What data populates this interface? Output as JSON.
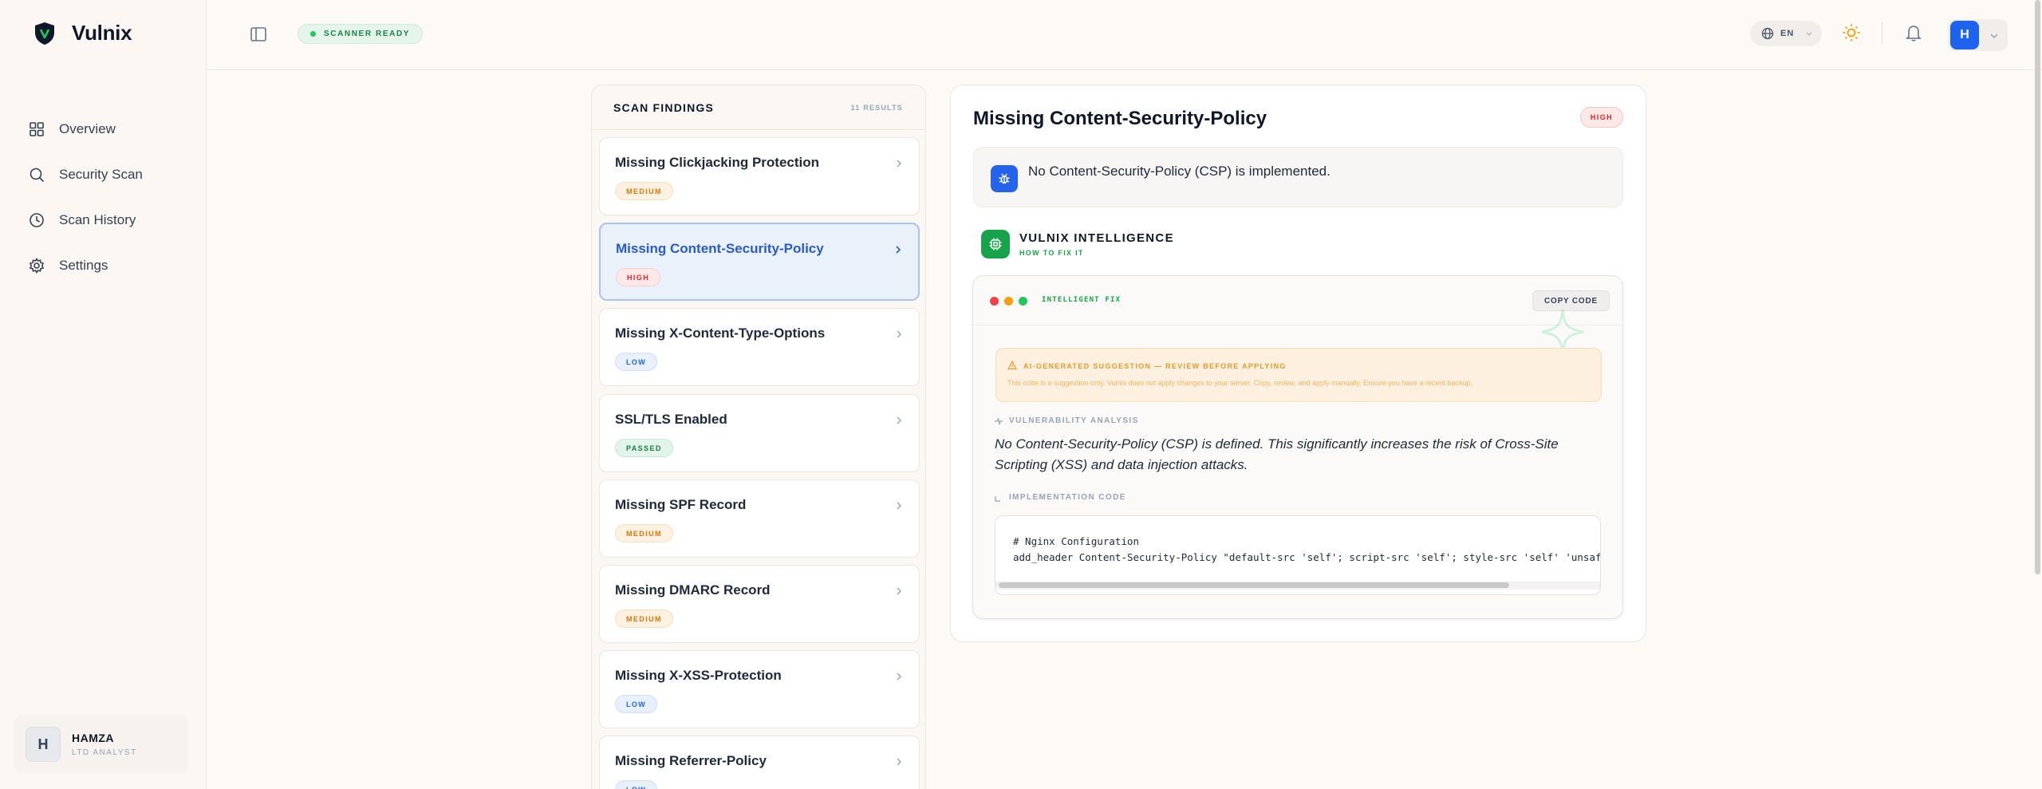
{
  "app": {
    "name": "Vulnix"
  },
  "sidebar": {
    "items": [
      {
        "label": "Overview",
        "icon": "grid-icon"
      },
      {
        "label": "Security Scan",
        "icon": "search-icon"
      },
      {
        "label": "Scan History",
        "icon": "clock-icon"
      },
      {
        "label": "Settings",
        "icon": "gear-icon"
      }
    ],
    "user": {
      "initial": "H",
      "name": "HAMZA",
      "role": "LTD ANALYST"
    }
  },
  "header": {
    "status": "SCANNER READY",
    "language": "EN",
    "avatar_initial": "H"
  },
  "findings": {
    "title": "SCAN FINDINGS",
    "count": "11 RESULTS",
    "items": [
      {
        "title": "Missing Clickjacking Protection",
        "severity": "MEDIUM"
      },
      {
        "title": "Missing Content-Security-Policy",
        "severity": "HIGH",
        "active": true
      },
      {
        "title": "Missing X-Content-Type-Options",
        "severity": "LOW"
      },
      {
        "title": "SSL/TLS Enabled",
        "severity": "PASSED"
      },
      {
        "title": "Missing SPF Record",
        "severity": "MEDIUM"
      },
      {
        "title": "Missing DMARC Record",
        "severity": "MEDIUM"
      },
      {
        "title": "Missing X-XSS-Protection",
        "severity": "LOW"
      },
      {
        "title": "Missing Referrer-Policy",
        "severity": "LOW"
      }
    ]
  },
  "detail": {
    "title": "Missing Content-Security-Policy",
    "severity": "HIGH",
    "description": "No Content-Security-Policy (CSP) is implemented.",
    "intel_title": "VULNIX INTELLIGENCE",
    "intel_subtitle": "HOW TO FIX IT",
    "fix": {
      "label": "INTELLIGENT FIX",
      "copy_label": "COPY CODE",
      "warning_title": "AI-GENERATED SUGGESTION — REVIEW BEFORE APPLYING",
      "warning_text": "This code is a suggestion only. Vulnix does not apply changes to your server. Copy, review, and apply manually. Ensure you have a recent backup.",
      "analysis_label": "VULNERABILITY ANALYSIS",
      "analysis_text": "No Content-Security-Policy (CSP) is defined. This significantly increases the risk of Cross-Site Scripting (XSS) and data injection attacks.",
      "code_label": "IMPLEMENTATION CODE",
      "code_line1": "# Nginx Configuration",
      "code_line2": "add_header Content-Security-Policy \"default-src 'self'; script-src 'self'; style-src 'self' 'unsafe-in"
    }
  },
  "colors": {
    "accent": "#2563eb",
    "success": "#16a34a",
    "high": "#dc2626",
    "medium": "#d97706"
  }
}
